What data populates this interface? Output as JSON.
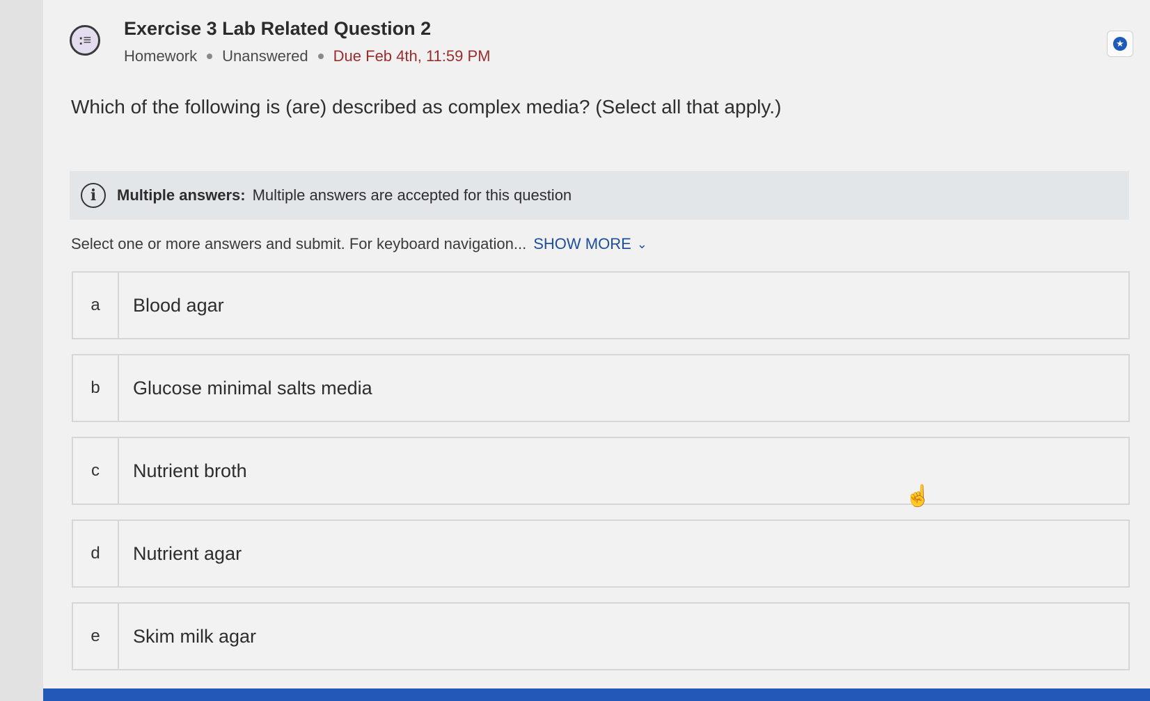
{
  "header": {
    "title": "Exercise 3 Lab Related Question 2",
    "type": "Homework",
    "status": "Unanswered",
    "due": "Due Feb 4th, 11:59 PM"
  },
  "question": {
    "text": "Which of the following is (are) described as complex media? (Select all that apply.)"
  },
  "info": {
    "label": "Multiple answers:",
    "text": "Multiple answers are accepted for this question"
  },
  "instructions": {
    "text": "Select one or more answers and submit. For keyboard navigation...",
    "show_more": "SHOW MORE"
  },
  "options": [
    {
      "letter": "a",
      "text": "Blood agar"
    },
    {
      "letter": "b",
      "text": "Glucose minimal salts media"
    },
    {
      "letter": "c",
      "text": "Nutrient broth"
    },
    {
      "letter": "d",
      "text": "Nutrient agar"
    },
    {
      "letter": "e",
      "text": "Skim milk agar"
    }
  ],
  "icons": {
    "question_type": "list-bubble-icon",
    "bookmark": "star-icon",
    "info": "info-icon",
    "chevron": "chevron-down-icon",
    "cursor": "hand-pointer-icon"
  },
  "colors": {
    "due": "#9b2c2c",
    "link": "#1e4e9a",
    "accent_bar": "#2458b8",
    "star": "#1e5bb8"
  }
}
